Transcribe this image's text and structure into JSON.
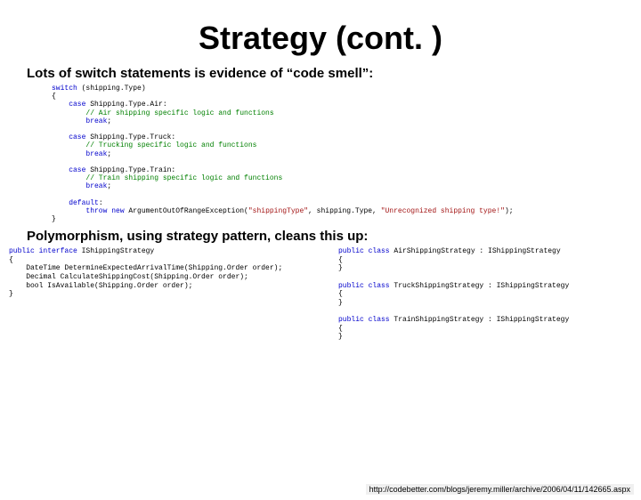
{
  "title": "Strategy (cont. )",
  "subhead1": "Lots of switch statements is evidence of “code smell”:",
  "switch_code": [
    {
      "t": "kw",
      "s": "switch"
    },
    {
      "t": "tx",
      "s": " (shipping.Type)"
    },
    {
      "t": "br"
    },
    {
      "t": "tx",
      "s": "{"
    },
    {
      "t": "br"
    },
    {
      "t": "tx",
      "s": "    "
    },
    {
      "t": "kw",
      "s": "case"
    },
    {
      "t": "tx",
      "s": " Shipping.Type.Air:"
    },
    {
      "t": "br"
    },
    {
      "t": "tx",
      "s": "        "
    },
    {
      "t": "cm",
      "s": "// Air shipping specific logic and functions"
    },
    {
      "t": "br"
    },
    {
      "t": "tx",
      "s": "        "
    },
    {
      "t": "kw",
      "s": "break"
    },
    {
      "t": "tx",
      "s": ";"
    },
    {
      "t": "br"
    },
    {
      "t": "br"
    },
    {
      "t": "tx",
      "s": "    "
    },
    {
      "t": "kw",
      "s": "case"
    },
    {
      "t": "tx",
      "s": " Shipping.Type.Truck:"
    },
    {
      "t": "br"
    },
    {
      "t": "tx",
      "s": "        "
    },
    {
      "t": "cm",
      "s": "// Trucking specific logic and functions"
    },
    {
      "t": "br"
    },
    {
      "t": "tx",
      "s": "        "
    },
    {
      "t": "kw",
      "s": "break"
    },
    {
      "t": "tx",
      "s": ";"
    },
    {
      "t": "br"
    },
    {
      "t": "br"
    },
    {
      "t": "tx",
      "s": "    "
    },
    {
      "t": "kw",
      "s": "case"
    },
    {
      "t": "tx",
      "s": " Shipping.Type.Train:"
    },
    {
      "t": "br"
    },
    {
      "t": "tx",
      "s": "        "
    },
    {
      "t": "cm",
      "s": "// Train shipping specific logic and functions"
    },
    {
      "t": "br"
    },
    {
      "t": "tx",
      "s": "        "
    },
    {
      "t": "kw",
      "s": "break"
    },
    {
      "t": "tx",
      "s": ";"
    },
    {
      "t": "br"
    },
    {
      "t": "br"
    },
    {
      "t": "tx",
      "s": "    "
    },
    {
      "t": "kw",
      "s": "default"
    },
    {
      "t": "tx",
      "s": ":"
    },
    {
      "t": "br"
    },
    {
      "t": "tx",
      "s": "        "
    },
    {
      "t": "kw",
      "s": "throw new"
    },
    {
      "t": "tx",
      "s": " ArgumentOutOfRangeException("
    },
    {
      "t": "str",
      "s": "\"shippingType\""
    },
    {
      "t": "tx",
      "s": ", shipping.Type, "
    },
    {
      "t": "str",
      "s": "\"Unrecognized shipping type!\""
    },
    {
      "t": "tx",
      "s": ");"
    },
    {
      "t": "br"
    },
    {
      "t": "tx",
      "s": "}"
    }
  ],
  "subhead2": "Polymorphism, using strategy pattern, cleans this up:",
  "left_code": [
    {
      "t": "kw",
      "s": "public interface"
    },
    {
      "t": "tx",
      "s": " IShippingStrategy"
    },
    {
      "t": "br"
    },
    {
      "t": "tx",
      "s": "{"
    },
    {
      "t": "br"
    },
    {
      "t": "tx",
      "s": "    DateTime DetermineExpectedArrivalTime(Shipping.Order order);"
    },
    {
      "t": "br"
    },
    {
      "t": "tx",
      "s": "    Decimal CalculateShippingCost(Shipping.Order order);"
    },
    {
      "t": "br"
    },
    {
      "t": "tx",
      "s": "    bool IsAvailable(Shipping.Order order);"
    },
    {
      "t": "br"
    },
    {
      "t": "tx",
      "s": "}"
    }
  ],
  "right_code": [
    {
      "t": "kw",
      "s": "public class"
    },
    {
      "t": "tx",
      "s": " AirShippingStrategy : IShippingStrategy"
    },
    {
      "t": "br"
    },
    {
      "t": "tx",
      "s": "{"
    },
    {
      "t": "br"
    },
    {
      "t": "tx",
      "s": "}"
    },
    {
      "t": "br"
    },
    {
      "t": "br"
    },
    {
      "t": "kw",
      "s": "public class"
    },
    {
      "t": "tx",
      "s": " TruckShippingStrategy : IShippingStrategy"
    },
    {
      "t": "br"
    },
    {
      "t": "tx",
      "s": "{"
    },
    {
      "t": "br"
    },
    {
      "t": "tx",
      "s": "}"
    },
    {
      "t": "br"
    },
    {
      "t": "br"
    },
    {
      "t": "kw",
      "s": "public class"
    },
    {
      "t": "tx",
      "s": " TrainShippingStrategy : IShippingStrategy"
    },
    {
      "t": "br"
    },
    {
      "t": "tx",
      "s": "{"
    },
    {
      "t": "br"
    },
    {
      "t": "tx",
      "s": "}"
    }
  ],
  "source_url": "http://codebetter.com/blogs/jeremy.miller/archive/2006/04/11/142665.aspx"
}
